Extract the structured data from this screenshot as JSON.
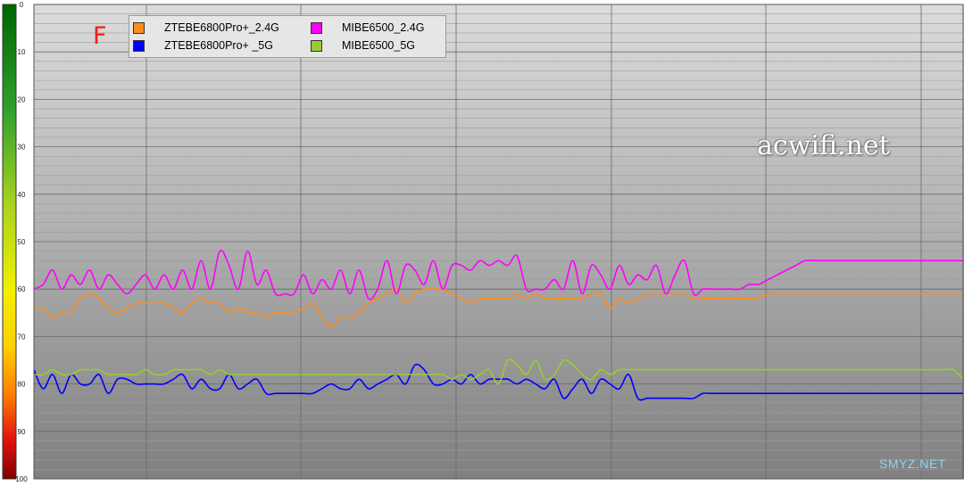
{
  "chart_data": {
    "type": "line",
    "y_axis": {
      "ylim": [
        0,
        100
      ],
      "inverted": true,
      "ticks": [
        "0",
        "10",
        "20",
        "30",
        "40",
        "50",
        "60",
        "70",
        "80",
        "90",
        "100"
      ]
    },
    "grid": true,
    "legend_placement": "top-left",
    "x": [
      0,
      1,
      2,
      3,
      4,
      5,
      6,
      7,
      8,
      9,
      10,
      11,
      12,
      13,
      14,
      15,
      16,
      17,
      18,
      19,
      20,
      21,
      22,
      23,
      24,
      25,
      26,
      27,
      28,
      29,
      30,
      31,
      32,
      33,
      34,
      35,
      36,
      37,
      38,
      39,
      40,
      41,
      42,
      43,
      44,
      45,
      46,
      47,
      48,
      49,
      50,
      51,
      52,
      53,
      54,
      55,
      56,
      57,
      58,
      59,
      60,
      61,
      62,
      63,
      64,
      65,
      66,
      67,
      68,
      69,
      70,
      71,
      72,
      73,
      74,
      75,
      76,
      77,
      78,
      79,
      80,
      81,
      82,
      83,
      84,
      85,
      86,
      87,
      88,
      89,
      90,
      91,
      92,
      93,
      94,
      95,
      96,
      97,
      98,
      99,
      100
    ],
    "series": [
      {
        "name": "ZTEBE6800Pro+_2.4G",
        "color": "#ff8c1a",
        "values": [
          64,
          64,
          66,
          65,
          65,
          62,
          61,
          62,
          64,
          65,
          64,
          63,
          63,
          63,
          63,
          64,
          65,
          63,
          62,
          63,
          63,
          65,
          64,
          65,
          65,
          66,
          65,
          65,
          65,
          64,
          63,
          66,
          68,
          66,
          66,
          65,
          63,
          62,
          61,
          60,
          63,
          61,
          60,
          60,
          60,
          61,
          62,
          63,
          62,
          62,
          62,
          62,
          61,
          62,
          61,
          62,
          62,
          62,
          62,
          62,
          61,
          61,
          64,
          62,
          63,
          62,
          61,
          61,
          61,
          61,
          61,
          62,
          62,
          62,
          62,
          62,
          62,
          62,
          62,
          61,
          61,
          61,
          61,
          61,
          61,
          61,
          61,
          61,
          61,
          61,
          61,
          61,
          61,
          61,
          61,
          61,
          61,
          61,
          61,
          61,
          61
        ]
      },
      {
        "name": "ZTEBE6800Pro+ _5G",
        "color": "#0000ff",
        "values": [
          77,
          81,
          78,
          82,
          78,
          80,
          80,
          78,
          82,
          79,
          79,
          80,
          80,
          80,
          80,
          79,
          78,
          81,
          79,
          81,
          81,
          78,
          81,
          80,
          79,
          82,
          82,
          82,
          82,
          82,
          82,
          81,
          80,
          81,
          81,
          79,
          81,
          80,
          79,
          78,
          80,
          76,
          77,
          80,
          80,
          79,
          80,
          78,
          80,
          79,
          79,
          79,
          80,
          79,
          80,
          81,
          79,
          83,
          81,
          79,
          82,
          79,
          80,
          81,
          78,
          83,
          83,
          83,
          83,
          83,
          83,
          83,
          82,
          82,
          82,
          82,
          82,
          82,
          82,
          82,
          82,
          82,
          82,
          82,
          82,
          82,
          82,
          82,
          82,
          82,
          82,
          82,
          82,
          82,
          82,
          82,
          82,
          82,
          82,
          82,
          82
        ]
      },
      {
        "name": "MIBE6500_2.4G",
        "color": "#ff00ff",
        "values": [
          60,
          59,
          56,
          60,
          57,
          59,
          56,
          60,
          57,
          59,
          61,
          59,
          57,
          60,
          57,
          60,
          56,
          60,
          54,
          60,
          52,
          55,
          60,
          52,
          59,
          56,
          61,
          61,
          61,
          57,
          61,
          58,
          60,
          56,
          61,
          56,
          62,
          60,
          54,
          61,
          55,
          56,
          59,
          54,
          60,
          55,
          55,
          56,
          54,
          55,
          54,
          55,
          53,
          60,
          60,
          60,
          58,
          60,
          54,
          61,
          55,
          57,
          60,
          55,
          59,
          57,
          58,
          55,
          61,
          57,
          54,
          61,
          60,
          60,
          60,
          60,
          60,
          59,
          59,
          58,
          57,
          56,
          55,
          54,
          54,
          54,
          54,
          54,
          54,
          54,
          54,
          54,
          54,
          54,
          54,
          54,
          54,
          54,
          54,
          54,
          54
        ]
      },
      {
        "name": "MIBE6500_5G",
        "color": "#99cc33",
        "values": [
          78,
          78,
          77,
          78,
          78,
          77,
          77,
          77,
          78,
          78,
          78,
          78,
          77,
          78,
          78,
          77,
          77,
          77,
          77,
          78,
          77,
          78,
          78,
          78,
          78,
          78,
          78,
          78,
          78,
          78,
          78,
          78,
          78,
          78,
          78,
          78,
          78,
          78,
          78,
          78,
          78,
          78,
          78,
          78,
          78,
          79,
          78,
          79,
          78,
          77,
          80,
          75,
          76,
          78,
          75,
          79,
          78,
          75,
          76,
          78,
          79,
          77,
          78,
          77,
          77,
          77,
          77,
          77,
          77,
          77,
          77,
          77,
          77,
          77,
          77,
          77,
          77,
          77,
          77,
          77,
          77,
          77,
          77,
          77,
          77,
          77,
          77,
          77,
          77,
          77,
          77,
          77,
          77,
          77,
          77,
          77,
          77,
          77,
          77,
          77,
          79
        ]
      }
    ]
  },
  "legend": {
    "items": [
      {
        "label": "ZTEBE6800Pro+_2.4G",
        "color": "#ff8c1a"
      },
      {
        "label": "ZTEBE6800Pro+ _5G",
        "color": "#0000ff"
      },
      {
        "label": "MIBE6500_2.4G",
        "color": "#ff00ff"
      },
      {
        "label": "MIBE6500_5G",
        "color": "#99cc33"
      }
    ]
  },
  "annotations": {
    "marker_letter": "F",
    "watermark": "acwifi.net",
    "watermark_corner": "SMYZ.NET"
  }
}
